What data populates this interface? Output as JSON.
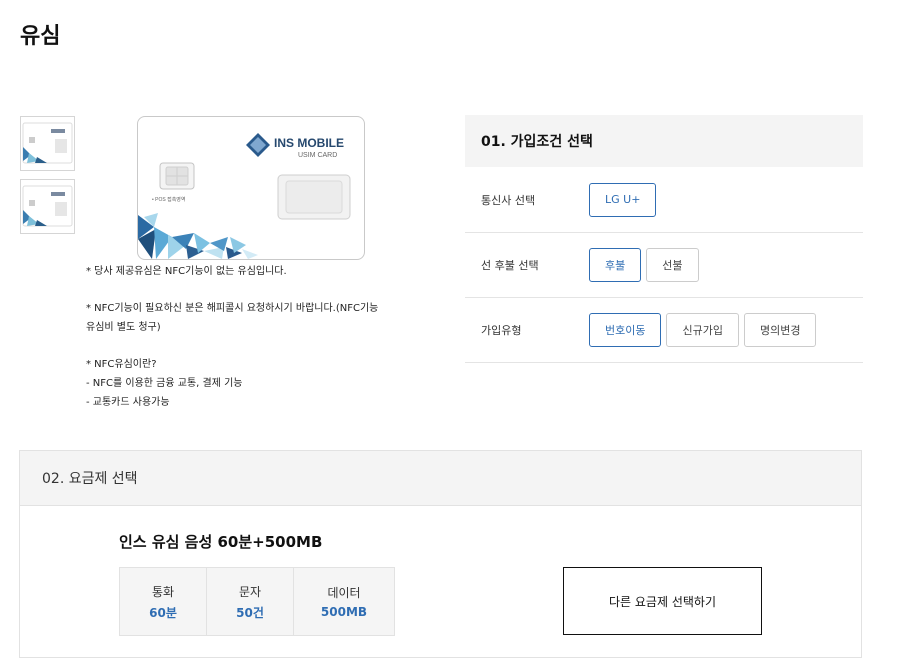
{
  "page": {
    "title": "유심"
  },
  "product": {
    "card_brand": "INS MOBILE",
    "card_subtitle": "USIM CARD",
    "pos_text": "• POS 접촉영역",
    "notes": [
      "* 당사 제공유심은 NFC기능이 없는 유심입니다.",
      "* NFC기능이 필요하신 분은 해피콜시 요청하시기 바랍니다.(NFC기능",
      "유심비 별도 청구)",
      "* NFC유심이란?",
      "- NFC를 이용한 금융 교통, 결제 기능",
      "- 교통카드 사용가능"
    ]
  },
  "conditions": {
    "title": "01. 가입조건 선택",
    "carrier": {
      "label": "통신사 선택",
      "options": [
        "LG U+"
      ],
      "selected": "LG U+"
    },
    "payment": {
      "label": "선 후불 선택",
      "options": [
        "후불",
        "선불"
      ],
      "selected": "후불"
    },
    "join_type": {
      "label": "가입유형",
      "options": [
        "번호이동",
        "신규가입",
        "명의변경"
      ],
      "selected": "번호이동"
    }
  },
  "plan": {
    "title": "02. 요금제 선택",
    "name": "인스 유심 음성 60분+500MB",
    "items": [
      {
        "label": "통화",
        "value": "60분"
      },
      {
        "label": "문자",
        "value": "50건"
      },
      {
        "label": "데이터",
        "value": "500MB"
      }
    ],
    "other_button": "다른 요금제 선택하기"
  },
  "colors": {
    "accent": "#2f6db3",
    "header_bg": "#f4f4f4",
    "border": "#e2e2e2"
  }
}
